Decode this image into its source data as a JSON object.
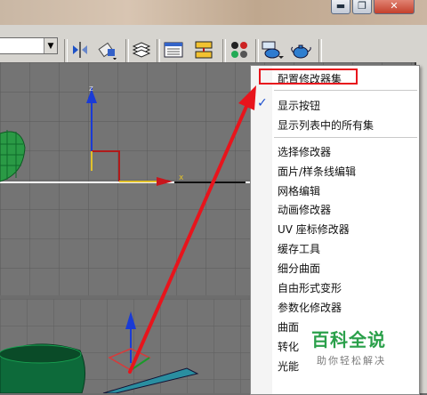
{
  "window": {
    "minimize_glyph": "▬",
    "restore_glyph": "❐",
    "close_glyph": "✕"
  },
  "toolbar": {
    "dropdown_value": "",
    "icons": [
      "mirror-icon",
      "align-icon",
      "layer-manager-icon",
      "curve-editor-icon",
      "schematic-view-icon",
      "material-editor-icon",
      "render-setup-icon",
      "render-teapot-icon"
    ]
  },
  "viewport": {
    "axis_label_x": "x"
  },
  "menu": {
    "items": [
      {
        "label": "配置修改器集",
        "checked": false
      },
      {
        "label": "显示按钮",
        "checked": true
      },
      {
        "label": "显示列表中的所有集",
        "checked": false
      },
      {
        "label": "选择修改器",
        "checked": false
      },
      {
        "label": "面片/样条线编辑",
        "checked": false
      },
      {
        "label": "网格编辑",
        "checked": false
      },
      {
        "label": "动画修改器",
        "checked": false
      },
      {
        "label": "UV 座标修改器",
        "checked": false
      },
      {
        "label": "缓存工具",
        "checked": false
      },
      {
        "label": "细分曲面",
        "checked": false
      },
      {
        "label": "自由形式变形",
        "checked": false
      },
      {
        "label": "参数化修改器",
        "checked": false
      },
      {
        "label": "曲面",
        "checked": false
      },
      {
        "label": "转化",
        "checked": false
      },
      {
        "label": "光能",
        "checked": false
      }
    ],
    "check_glyph": "✓"
  },
  "watermark": {
    "title": "百科全说",
    "subtitle": "助你轻松解决"
  },
  "colors": {
    "highlight": "#e8141c",
    "arrow": "#e8141c",
    "axis_y": "#1a3bd6",
    "axis_x": "#e21a1a",
    "geometry": "#1f8f3a",
    "brand_green": "#2aa04a"
  }
}
